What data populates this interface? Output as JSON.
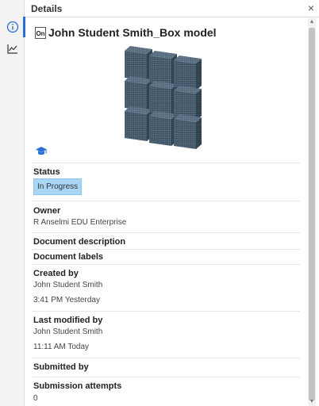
{
  "header": {
    "title": "Details",
    "close_glyph": "×"
  },
  "rail": {
    "items": [
      {
        "icon": "info-icon",
        "active": true
      },
      {
        "icon": "chart-icon",
        "active": false
      }
    ]
  },
  "document": {
    "badge": "On",
    "name": "John Student Smith_Box model"
  },
  "status": {
    "label": "Status",
    "value": "In Progress"
  },
  "owner": {
    "label": "Owner",
    "value": "R Anselmi EDU Enterprise"
  },
  "description": {
    "label": "Document description"
  },
  "labels": {
    "label": "Document labels"
  },
  "created": {
    "label": "Created by",
    "user": "John Student Smith",
    "time": "3:41 PM Yesterday"
  },
  "modified": {
    "label": "Last modified by",
    "user": "John Student Smith",
    "time": "11:11 AM Today"
  },
  "submitted": {
    "label": "Submitted by"
  },
  "attempts": {
    "label": "Submission attempts",
    "value": "0"
  },
  "colors": {
    "accent": "#2a6fd6",
    "status_badge": "#a9d6f7",
    "cube": "#3a4d5e"
  }
}
